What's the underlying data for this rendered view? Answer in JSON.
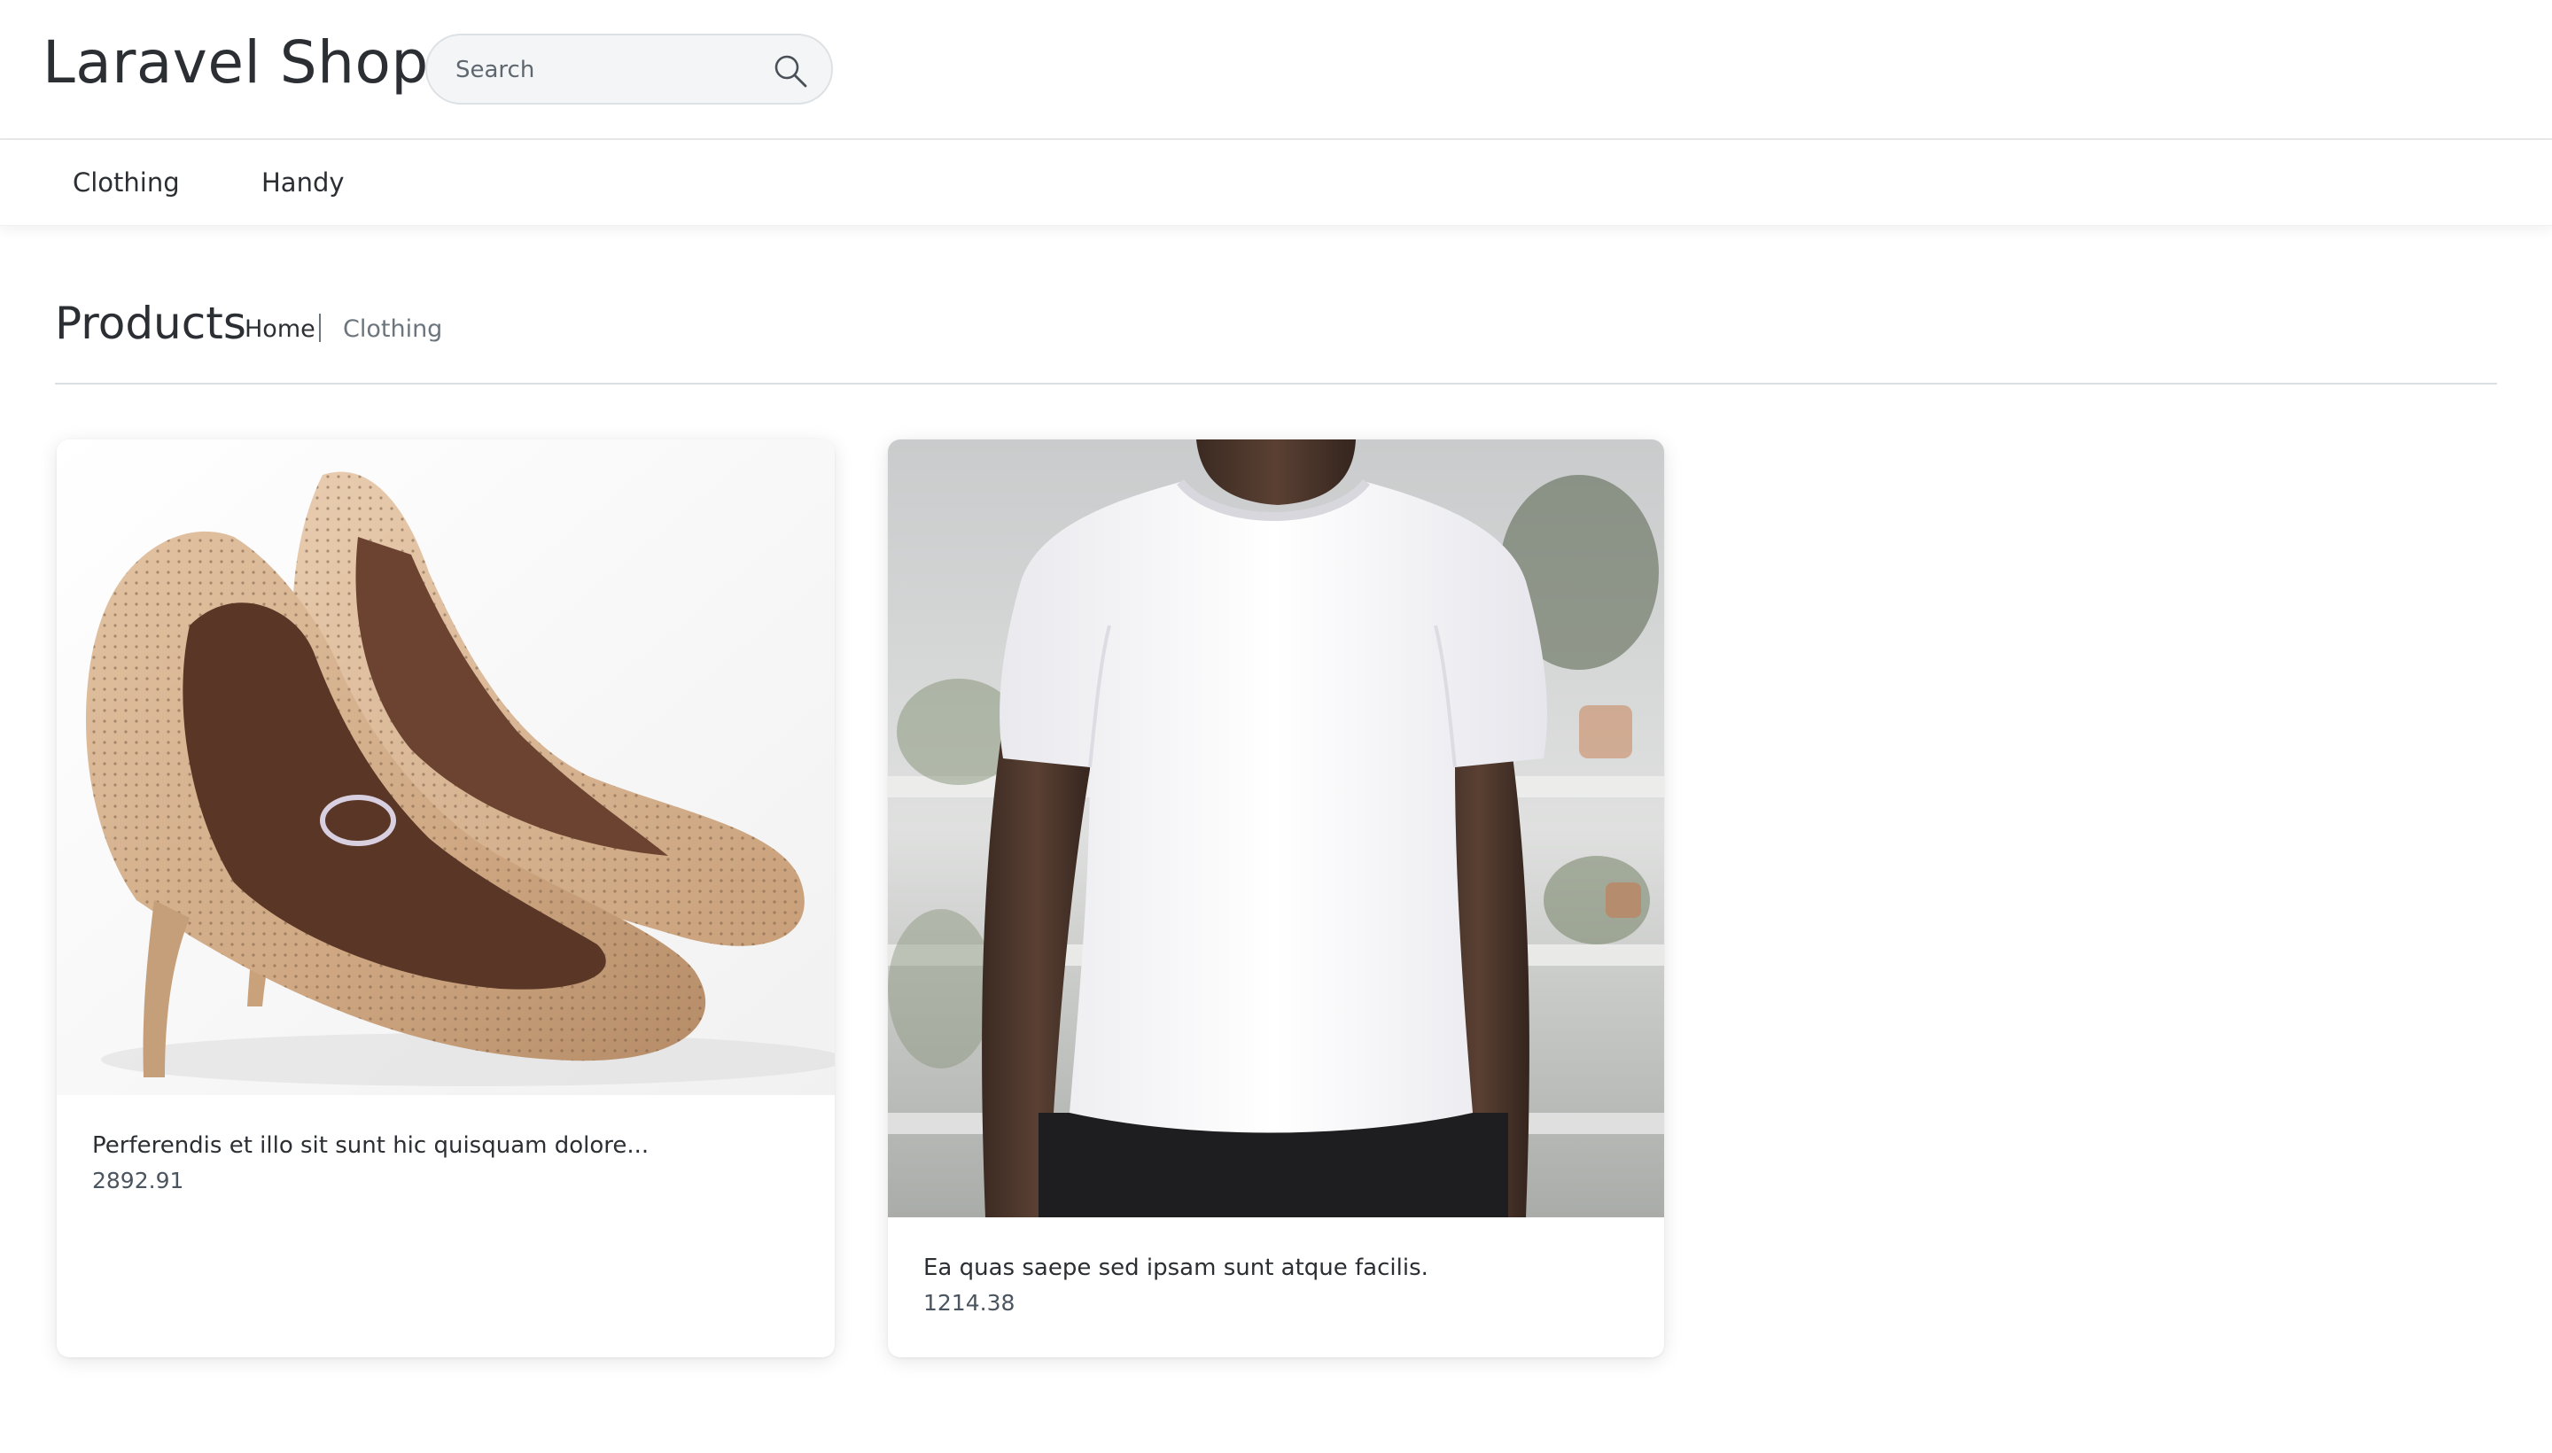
{
  "header": {
    "brand": "Laravel Shop",
    "search": {
      "placeholder": "Search",
      "value": "",
      "icon": "search-icon"
    }
  },
  "nav": {
    "items": [
      {
        "label": "Clothing"
      },
      {
        "label": "Handy"
      }
    ]
  },
  "page": {
    "title": "Products",
    "breadcrumb": [
      {
        "label": "Home"
      },
      {
        "label": "Clothing"
      }
    ]
  },
  "products": [
    {
      "title": "Perferendis et illo sit sunt hic quisquam dolore...",
      "price": "2892.91",
      "image": "beige-high-heel-shoes"
    },
    {
      "title": "Ea quas saepe sed ipsam sunt atque facilis.",
      "price": "1214.38",
      "image": "white-t-shirt-model"
    }
  ],
  "colors": {
    "text": "#2b2f33",
    "muted": "#6c757d",
    "border": "#dcdfe2"
  }
}
